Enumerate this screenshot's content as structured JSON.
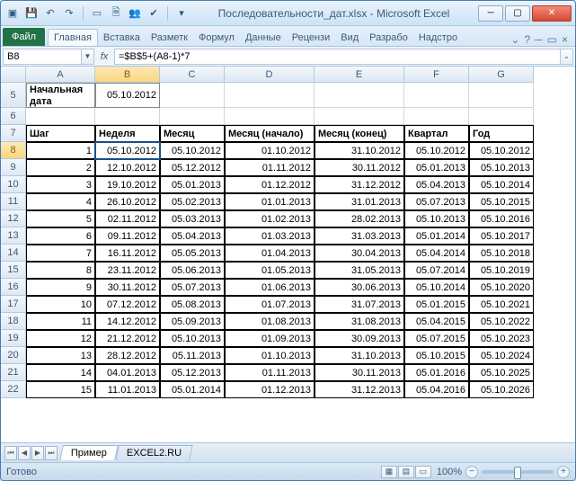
{
  "title": "Последовательности_дат.xlsx - Microsoft Excel",
  "qat_icons": [
    "excel-icon",
    "save-icon",
    "undo-icon",
    "redo-icon",
    "sep",
    "new-icon",
    "print-preview-icon",
    "users-icon",
    "spell-icon",
    "sep",
    "customize-icon"
  ],
  "ribbon": {
    "file": "Файл",
    "tabs": [
      "Главная",
      "Вставка",
      "Разметк",
      "Формул",
      "Данные",
      "Рецензи",
      "Вид",
      "Разрабо",
      "Надстро"
    ]
  },
  "name_box": "B8",
  "formula": "=$B$5+(A8-1)*7",
  "columns": [
    "A",
    "B",
    "C",
    "D",
    "E",
    "F",
    "G"
  ],
  "labels": {
    "start_date_line1": "Начальная",
    "start_date_line2": "дата",
    "start_date_val": "05.10.2012"
  },
  "headers": [
    "Шаг",
    "Неделя",
    "Месяц",
    "Месяц (начало)",
    "Месяц (конец)",
    "Квартал",
    "Год"
  ],
  "rows_visible": [
    5,
    6,
    7,
    8,
    9,
    10,
    11,
    12,
    13,
    14,
    15,
    16,
    17,
    18,
    19,
    20,
    21,
    22
  ],
  "data": [
    {
      "step": 1,
      "w": "05.10.2012",
      "m": "05.10.2012",
      "ms": "01.10.2012",
      "me": "31.10.2012",
      "q": "05.10.2012",
      "y": "05.10.2012"
    },
    {
      "step": 2,
      "w": "12.10.2012",
      "m": "05.12.2012",
      "ms": "01.11.2012",
      "me": "30.11.2012",
      "q": "05.01.2013",
      "y": "05.10.2013"
    },
    {
      "step": 3,
      "w": "19.10.2012",
      "m": "05.01.2013",
      "ms": "01.12.2012",
      "me": "31.12.2012",
      "q": "05.04.2013",
      "y": "05.10.2014"
    },
    {
      "step": 4,
      "w": "26.10.2012",
      "m": "05.02.2013",
      "ms": "01.01.2013",
      "me": "31.01.2013",
      "q": "05.07.2013",
      "y": "05.10.2015"
    },
    {
      "step": 5,
      "w": "02.11.2012",
      "m": "05.03.2013",
      "ms": "01.02.2013",
      "me": "28.02.2013",
      "q": "05.10.2013",
      "y": "05.10.2016"
    },
    {
      "step": 6,
      "w": "09.11.2012",
      "m": "05.04.2013",
      "ms": "01.03.2013",
      "me": "31.03.2013",
      "q": "05.01.2014",
      "y": "05.10.2017"
    },
    {
      "step": 7,
      "w": "16.11.2012",
      "m": "05.05.2013",
      "ms": "01.04.2013",
      "me": "30.04.2013",
      "q": "05.04.2014",
      "y": "05.10.2018"
    },
    {
      "step": 8,
      "w": "23.11.2012",
      "m": "05.06.2013",
      "ms": "01.05.2013",
      "me": "31.05.2013",
      "q": "05.07.2014",
      "y": "05.10.2019"
    },
    {
      "step": 9,
      "w": "30.11.2012",
      "m": "05.07.2013",
      "ms": "01.06.2013",
      "me": "30.06.2013",
      "q": "05.10.2014",
      "y": "05.10.2020"
    },
    {
      "step": 10,
      "w": "07.12.2012",
      "m": "05.08.2013",
      "ms": "01.07.2013",
      "me": "31.07.2013",
      "q": "05.01.2015",
      "y": "05.10.2021"
    },
    {
      "step": 11,
      "w": "14.12.2012",
      "m": "05.09.2013",
      "ms": "01.08.2013",
      "me": "31.08.2013",
      "q": "05.04.2015",
      "y": "05.10.2022"
    },
    {
      "step": 12,
      "w": "21.12.2012",
      "m": "05.10.2013",
      "ms": "01.09.2013",
      "me": "30.09.2013",
      "q": "05.07.2015",
      "y": "05.10.2023"
    },
    {
      "step": 13,
      "w": "28.12.2012",
      "m": "05.11.2013",
      "ms": "01.10.2013",
      "me": "31.10.2013",
      "q": "05.10.2015",
      "y": "05.10.2024"
    },
    {
      "step": 14,
      "w": "04.01.2013",
      "m": "05.12.2013",
      "ms": "01.11.2013",
      "me": "30.11.2013",
      "q": "05.01.2016",
      "y": "05.10.2025"
    },
    {
      "step": 15,
      "w": "11.01.2013",
      "m": "05.01.2014",
      "ms": "01.12.2013",
      "me": "31.12.2013",
      "q": "05.04.2016",
      "y": "05.10.2026"
    }
  ],
  "sheets": [
    "Пример",
    "EXCEL2.RU"
  ],
  "status": {
    "ready": "Готово",
    "zoom": "100%"
  }
}
